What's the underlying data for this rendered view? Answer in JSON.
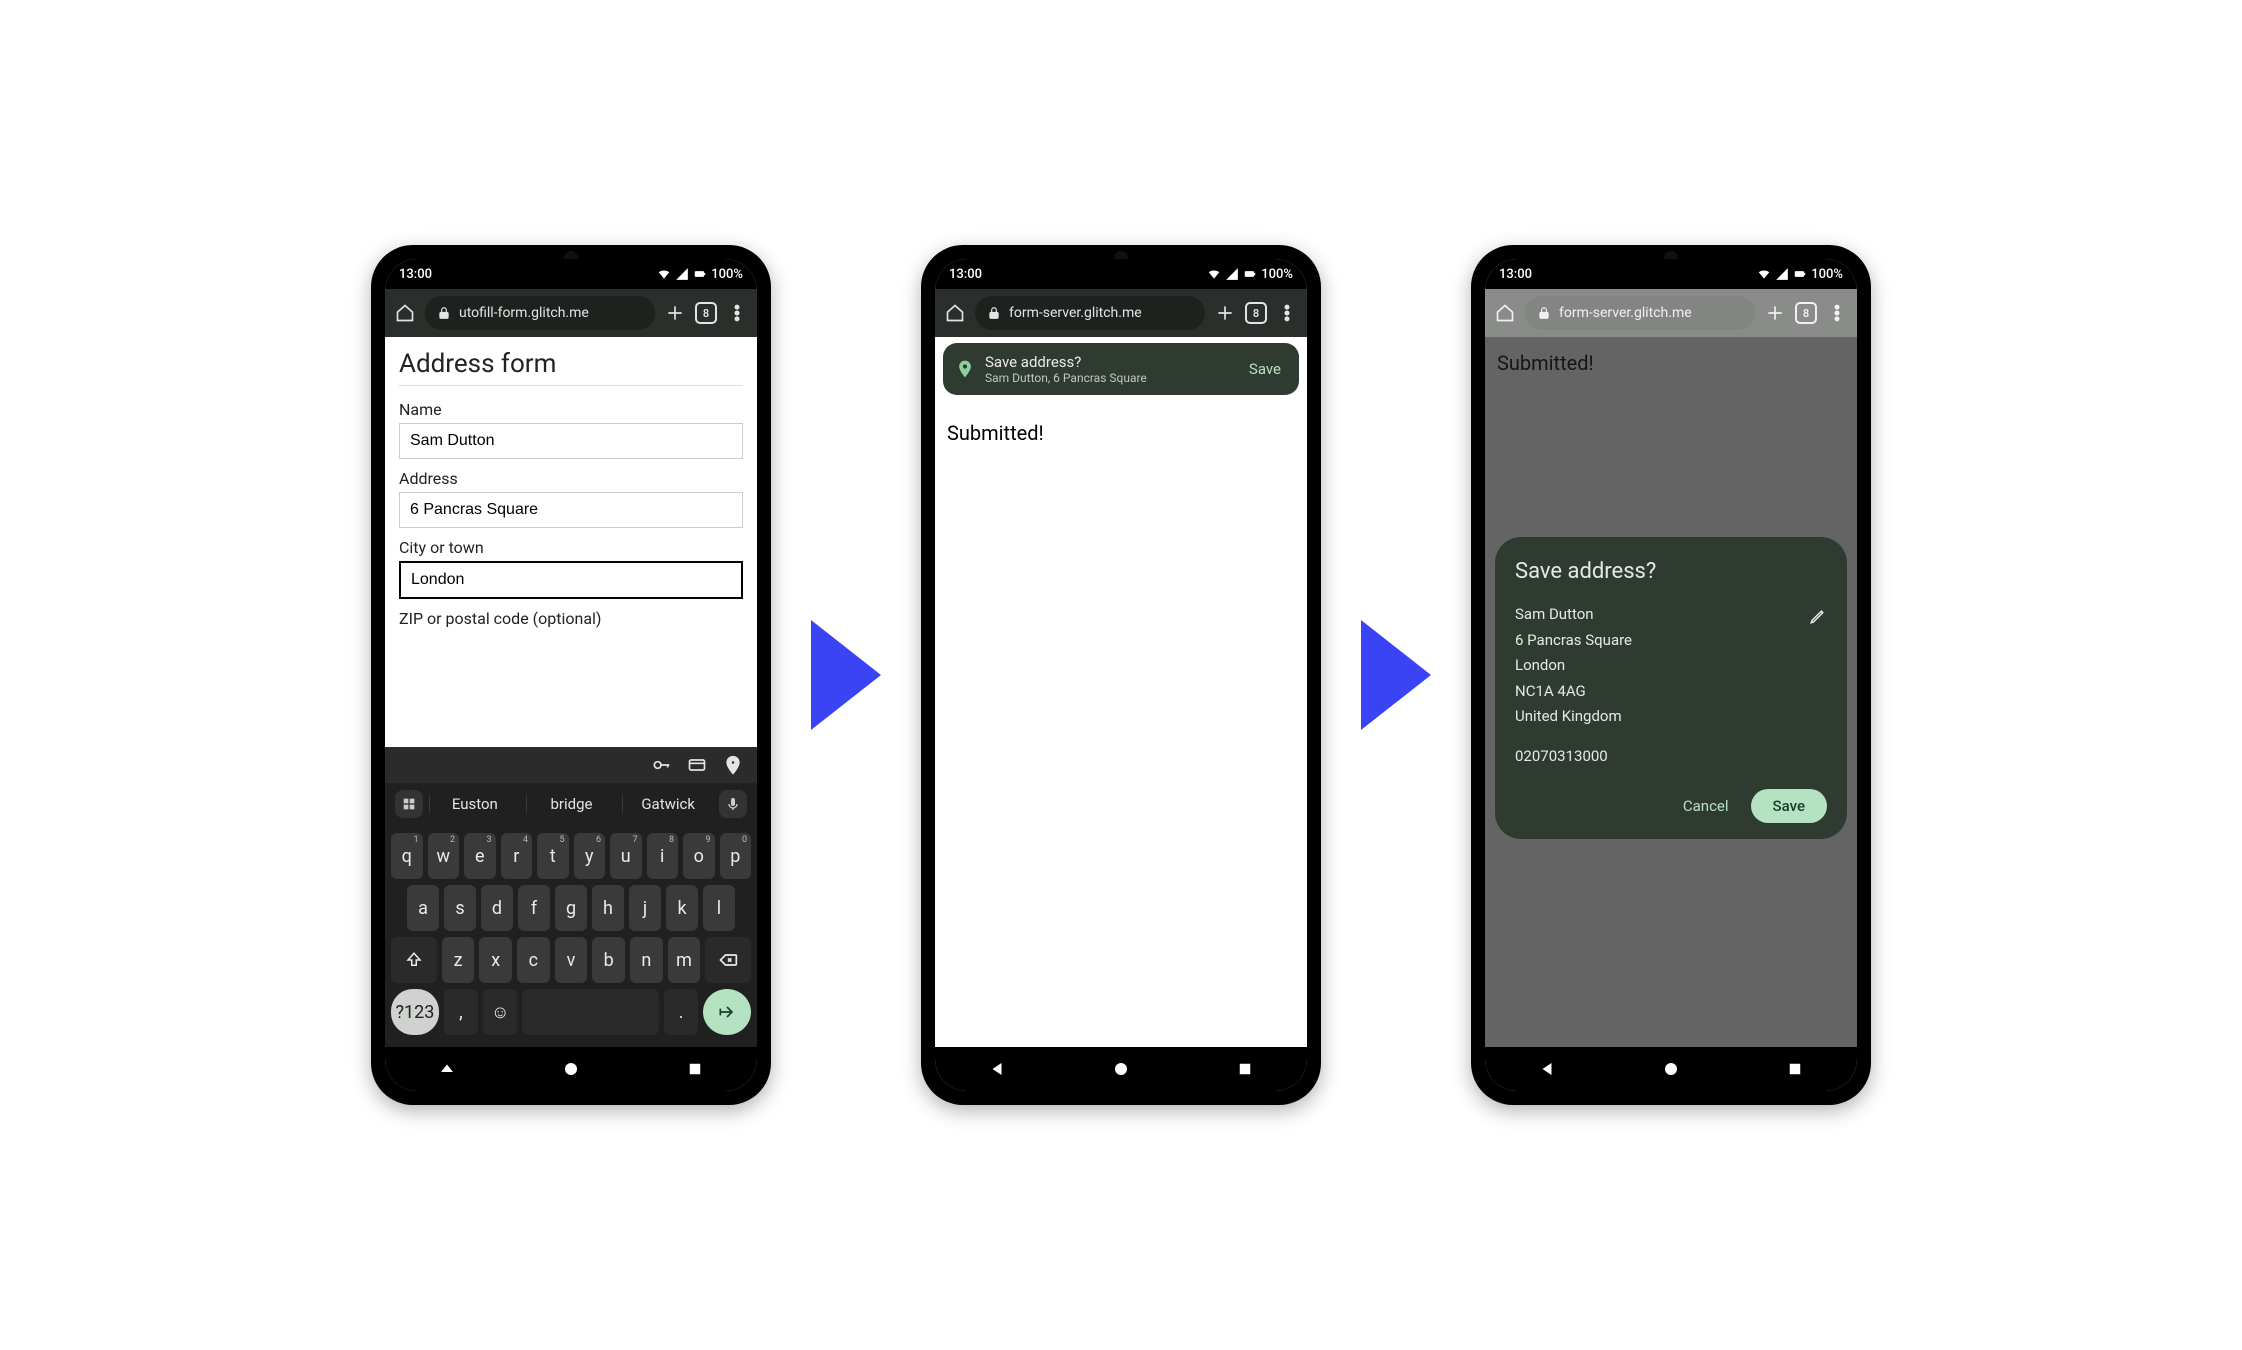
{
  "status": {
    "time": "13:00",
    "battery": "100%"
  },
  "browser": {
    "tab_count": "8"
  },
  "arrow_color": "#3b44f5",
  "phone1": {
    "url": "utofill-form.glitch.me",
    "page_title": "Address form",
    "labels": {
      "name": "Name",
      "address": "Address",
      "city": "City or town",
      "zip": "ZIP or postal code (optional)"
    },
    "values": {
      "name": "Sam Dutton",
      "address": "6 Pancras Square",
      "city": "London"
    },
    "suggestions": [
      "Euston",
      "bridge",
      "Gatwick"
    ],
    "keyboard": {
      "row1": [
        "q",
        "w",
        "e",
        "r",
        "t",
        "y",
        "u",
        "i",
        "o",
        "p"
      ],
      "row1_sup": [
        "1",
        "2",
        "3",
        "4",
        "5",
        "6",
        "7",
        "8",
        "9",
        "0"
      ],
      "row2": [
        "a",
        "s",
        "d",
        "f",
        "g",
        "h",
        "j",
        "k",
        "l"
      ],
      "row3": [
        "z",
        "x",
        "c",
        "v",
        "b",
        "n",
        "m"
      ],
      "num_key": "?123",
      "comma": ",",
      "period": "."
    }
  },
  "phone2": {
    "url": "form-server.glitch.me",
    "heading": "Submitted!",
    "toast": {
      "title": "Save address?",
      "subtitle": "Sam Dutton, 6 Pancras Square",
      "action": "Save"
    }
  },
  "phone3": {
    "url": "form-server.glitch.me",
    "heading": "Submitted!",
    "sheet": {
      "title": "Save address?",
      "lines": [
        "Sam Dutton",
        "6 Pancras Square",
        "London",
        "NC1A 4AG",
        "United Kingdom"
      ],
      "phone": "02070313000",
      "cancel": "Cancel",
      "save": "Save"
    }
  }
}
